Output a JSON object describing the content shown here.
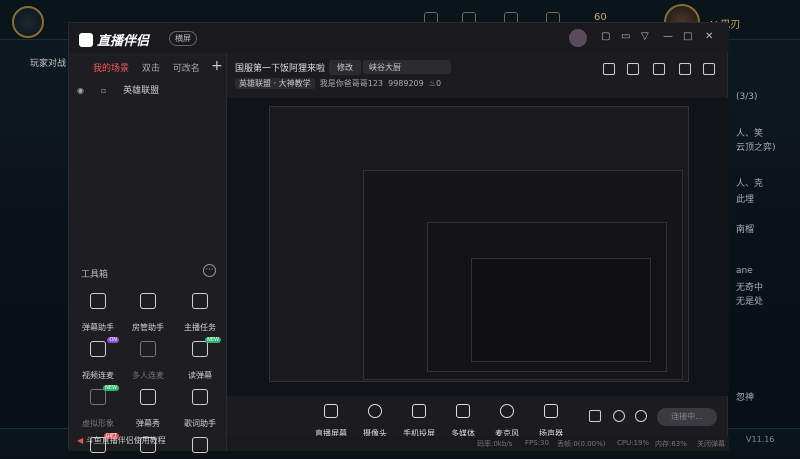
{
  "lol": {
    "play_label": "",
    "side_tab": "玩家对战",
    "gold": "60",
    "username": "AL巴刃",
    "version": "V11.16",
    "chat_lines": [
      "(3/3)",
      "人、笑",
      "云顶之弈)",
      "人、克",
      "此埋",
      "南榴",
      "ane",
      "无奇中",
      "无是处",
      "忽神"
    ]
  },
  "app": {
    "name": "直播伴侣",
    "version_badge": "横屏",
    "window_buttons": [
      "—",
      "□",
      "✕"
    ],
    "tabs": [
      "我的场景",
      "双击",
      "可改名"
    ],
    "scene_name": "英雄联盟",
    "tools_label": "工具箱",
    "tools": [
      {
        "label": "弹幕助手",
        "icon": "danmu-icon",
        "tag": ""
      },
      {
        "label": "房管助手",
        "icon": "admin-icon",
        "tag": ""
      },
      {
        "label": "主播任务",
        "icon": "task-icon",
        "tag": ""
      },
      {
        "label": "视频连麦",
        "icon": "video-link-icon",
        "tag": "ON"
      },
      {
        "label": "多人连麦",
        "icon": "multi-link-icon",
        "tag": ""
      },
      {
        "label": "读弹幕",
        "icon": "read-danmu-icon",
        "tag": "NEW"
      },
      {
        "label": "虚拟形象",
        "icon": "avatar-icon",
        "tag": "NEW"
      },
      {
        "label": "弹幕秀",
        "icon": "danmu-show-icon",
        "tag": ""
      },
      {
        "label": "歌词助手",
        "icon": "lyrics-icon",
        "tag": ""
      },
      {
        "label": "",
        "icon": "gift-icon",
        "tag": "GIFT"
      },
      {
        "label": "",
        "icon": "drawer-icon",
        "tag": ""
      },
      {
        "label": "",
        "icon": "stack-icon",
        "tag": ""
      }
    ],
    "room_title": "国服第一下饭阿狸来啦",
    "edit_button": "修改",
    "category_field": "峡谷大厨",
    "category_tag": "英雄联盟 · 大神教学",
    "anchor_info": "我是你爸哥哥123",
    "room_id": "9989209",
    "heat": "0",
    "controls": [
      "直播屏幕",
      "摄像头",
      "手机投屏",
      "多媒体",
      "麦克风",
      "扬声器"
    ],
    "live_button": "连接中...",
    "status": {
      "speed": "码率:0kb/s",
      "fps": "FPS:30",
      "drop": "丢帧:0(0.00%)",
      "cpu": "CPU:19%",
      "mem": "内存:63%",
      "close": "关闭弹幕"
    },
    "helper_text": "斗鱼直播伴侣使用教程"
  },
  "colors": {
    "accent": "#f25b5b",
    "panel": "#1c1c20",
    "bg": "#0b1218"
  }
}
